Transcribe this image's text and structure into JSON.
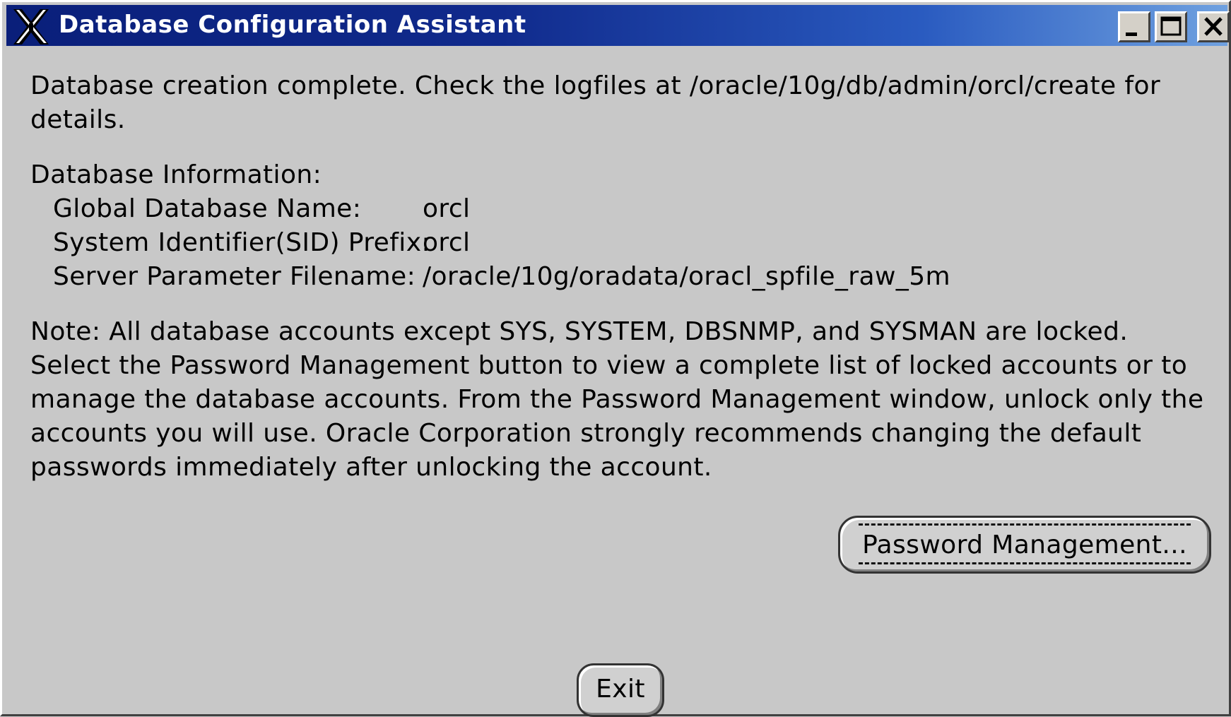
{
  "window": {
    "title": "Database Configuration Assistant",
    "titlebar_colors": [
      "#0a1f7a",
      "#6fa1e0"
    ],
    "background": "#c8c8c8",
    "icon": "x-window-logo-icon",
    "controls": [
      "minimize-icon",
      "maximize-icon",
      "close-icon"
    ]
  },
  "message": {
    "completion": "Database creation complete. Check the logfiles at /oracle/10g/db/admin/orcl/create for details."
  },
  "info": {
    "heading": "Database Information:",
    "rows": [
      {
        "label": "Global Database Name:",
        "value": "orcl"
      },
      {
        "label": "System Identifier(SID) Prefix:",
        "value": "orcl"
      },
      {
        "label": "Server Parameter Filename:",
        "value": "/oracle/10g/oradata/oracl_spfile_raw_5m"
      }
    ]
  },
  "note": {
    "text": "Note: All database accounts except SYS, SYSTEM, DBSNMP, and SYSMAN are locked. Select the Password Management button to view a complete list of locked accounts or to manage the database accounts. From the Password Management window, unlock only the accounts you will use. Oracle Corporation strongly recommends changing the default passwords immediately after unlocking the account."
  },
  "buttons": {
    "password_management": "Password Management...",
    "exit": "Exit"
  }
}
